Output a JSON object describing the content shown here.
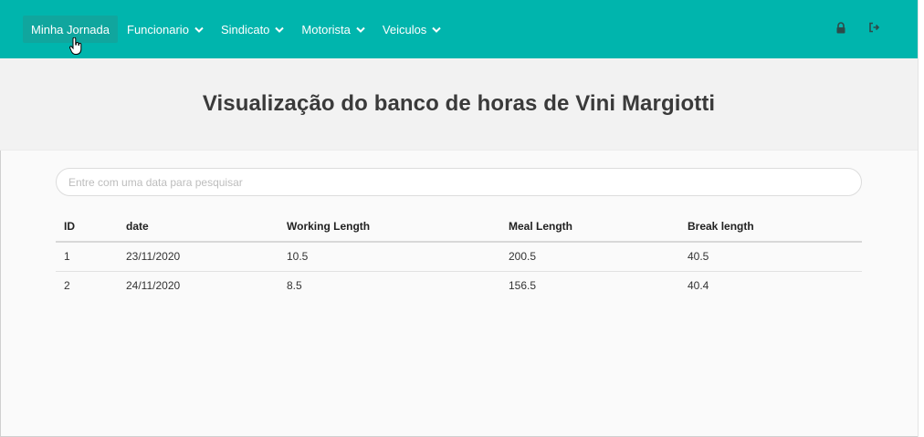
{
  "nav": {
    "items": [
      {
        "label": "Minha Jornada",
        "dropdown": false,
        "active": true
      },
      {
        "label": "Funcionario",
        "dropdown": true
      },
      {
        "label": "Sindicato",
        "dropdown": true
      },
      {
        "label": "Motorista",
        "dropdown": true
      },
      {
        "label": "Veiculos",
        "dropdown": true
      }
    ],
    "right_icons": [
      "lock-icon",
      "sign-out-icon"
    ]
  },
  "hero": {
    "title": "Visualização do banco de horas de Vini Margiotti"
  },
  "search": {
    "placeholder": "Entre com uma data para pesquisar",
    "value": ""
  },
  "table": {
    "headers": [
      "ID",
      "date",
      "Working Length",
      "Meal Length",
      "Break length"
    ],
    "rows": [
      [
        "1",
        "23/11/2020",
        "10.5",
        "200.5",
        "40.5"
      ],
      [
        "2",
        "24/11/2020",
        "8.5",
        "156.5",
        "40.4"
      ]
    ]
  },
  "colors": {
    "nav_bg": "#00b5ad",
    "nav_active": "#10a69e",
    "hero_bg": "#f2f2f2"
  }
}
